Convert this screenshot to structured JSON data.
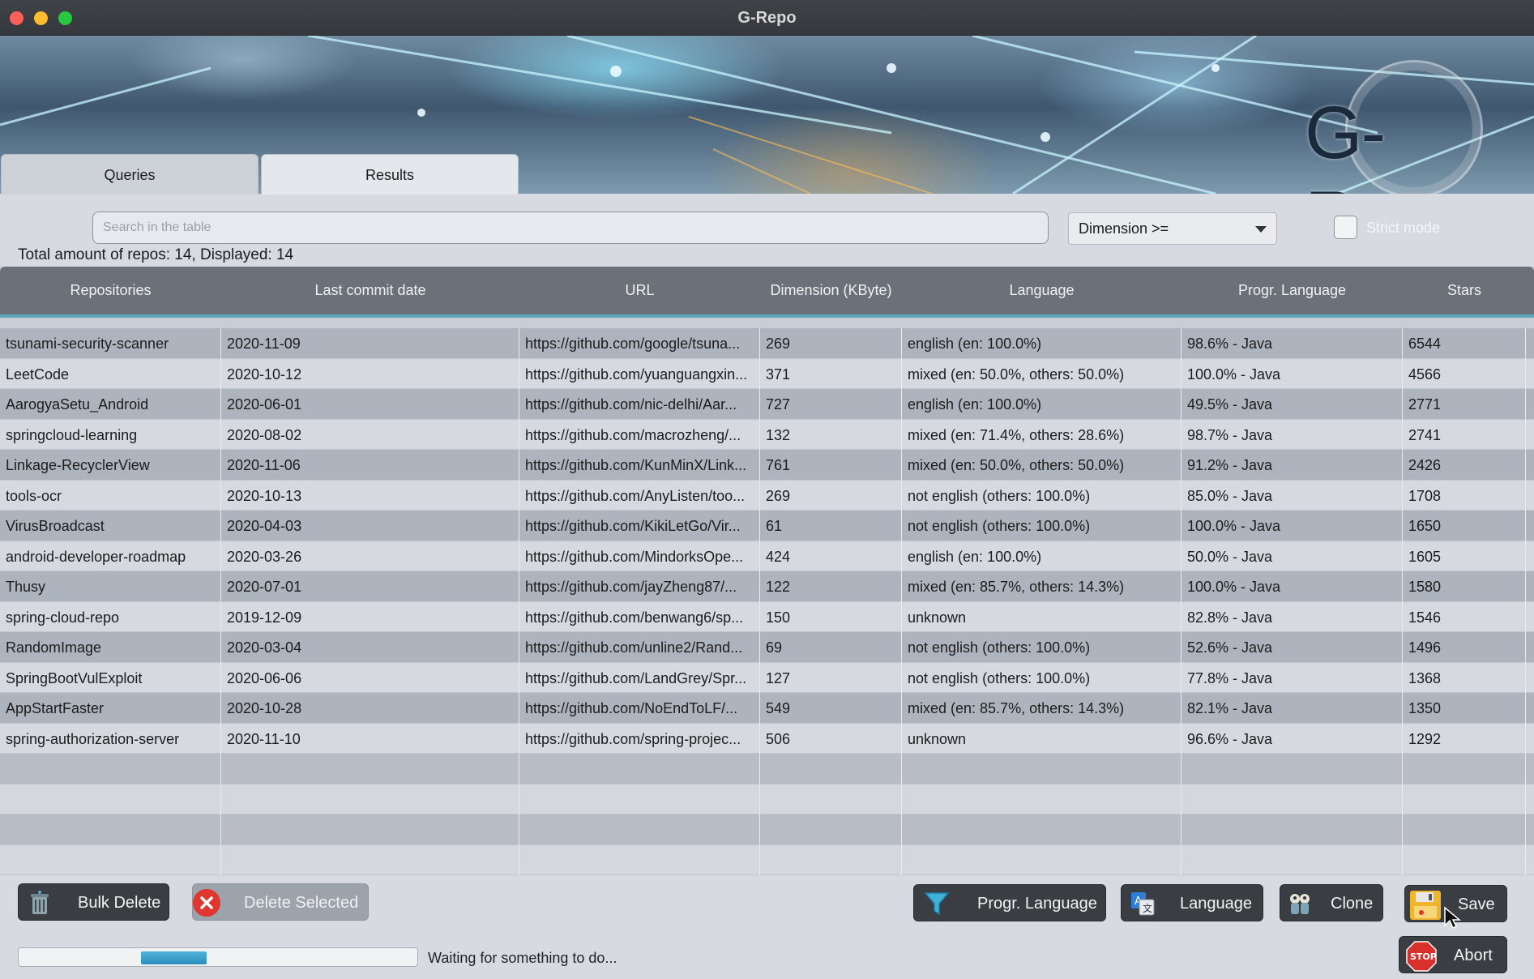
{
  "window": {
    "title": "G-Repo"
  },
  "banner": {
    "logo_text": "G-Repo"
  },
  "tabs": [
    {
      "label": "Queries",
      "active": false
    },
    {
      "label": "Results",
      "active": true
    }
  ],
  "search": {
    "placeholder": "Search in the table",
    "value": ""
  },
  "filter": {
    "selected": "Dimension >="
  },
  "strict_mode": {
    "label": "Strict mode",
    "checked": false
  },
  "summary": {
    "text": "Total amount of repos: 14, Displayed: 14"
  },
  "table": {
    "columns": [
      "Repositories",
      "Last commit date",
      "URL",
      "Dimension (KByte)",
      "Language",
      "Progr. Language",
      "Stars"
    ],
    "rows": [
      [
        "tsunami-security-scanner",
        "2020-11-09",
        "https://github.com/google/tsuna...",
        "269",
        "english (en: 100.0%)",
        "98.6% - Java",
        "6544"
      ],
      [
        "LeetCode",
        "2020-10-12",
        "https://github.com/yuanguangxin...",
        "371",
        "mixed (en: 50.0%, others: 50.0%)",
        "100.0% - Java",
        "4566"
      ],
      [
        "AarogyaSetu_Android",
        "2020-06-01",
        "https://github.com/nic-delhi/Aar...",
        "727",
        "english (en: 100.0%)",
        "49.5% - Java",
        "2771"
      ],
      [
        "springcloud-learning",
        "2020-08-02",
        "https://github.com/macrozheng/...",
        "132",
        "mixed (en: 71.4%, others: 28.6%)",
        "98.7% - Java",
        "2741"
      ],
      [
        "Linkage-RecyclerView",
        "2020-11-06",
        "https://github.com/KunMinX/Link...",
        "761",
        "mixed (en: 50.0%, others: 50.0%)",
        "91.2% - Java",
        "2426"
      ],
      [
        "tools-ocr",
        "2020-10-13",
        "https://github.com/AnyListen/too...",
        "269",
        "not english (others: 100.0%)",
        "85.0% - Java",
        "1708"
      ],
      [
        "VirusBroadcast",
        "2020-04-03",
        "https://github.com/KikiLetGo/Vir...",
        "61",
        "not english (others: 100.0%)",
        "100.0% - Java",
        "1650"
      ],
      [
        "android-developer-roadmap",
        "2020-03-26",
        "https://github.com/MindorksOpe...",
        "424",
        "english (en: 100.0%)",
        "50.0% - Java",
        "1605"
      ],
      [
        "Thusy",
        "2020-07-01",
        "https://github.com/jayZheng87/...",
        "122",
        "mixed (en: 85.7%, others: 14.3%)",
        "100.0% - Java",
        "1580"
      ],
      [
        "spring-cloud-repo",
        "2019-12-09",
        "https://github.com/benwang6/sp...",
        "150",
        "unknown",
        "82.8% - Java",
        "1546"
      ],
      [
        "RandomImage",
        "2020-03-04",
        "https://github.com/unline2/Rand...",
        "69",
        "not english (others: 100.0%)",
        "52.6% - Java",
        "1496"
      ],
      [
        "SpringBootVulExploit",
        "2020-06-06",
        "https://github.com/LandGrey/Spr...",
        "127",
        "not english (others: 100.0%)",
        "77.8% - Java",
        "1368"
      ],
      [
        "AppStartFaster",
        "2020-10-28",
        "https://github.com/NoEndToLF/...",
        "549",
        "mixed (en: 85.7%, others: 14.3%)",
        "82.1% - Java",
        "1350"
      ],
      [
        "spring-authorization-server",
        "2020-11-10",
        "https://github.com/spring-projec...",
        "506",
        "unknown",
        "96.6% - Java",
        "1292"
      ]
    ]
  },
  "buttons": {
    "bulk_delete": {
      "label": "Bulk Delete",
      "icon": "trash-bin-icon"
    },
    "delete_selected": {
      "label": "Delete Selected",
      "icon": "red-x-circle-icon"
    },
    "progr_language": {
      "label": "Progr. Language",
      "icon": "funnel-filter-icon"
    },
    "language": {
      "label": "Language",
      "icon": "translate-icon"
    },
    "clone": {
      "label": "Clone",
      "icon": "sheep-clone-icon"
    },
    "save": {
      "label": "Save",
      "icon": "floppy-disk-icon"
    },
    "abort": {
      "label": "Abort",
      "icon": "stop-sign-icon"
    }
  },
  "status": {
    "progress": 0.16,
    "text": "Waiting for something to do..."
  },
  "colors": {
    "header_bg": "#6b7178",
    "header_accent": "#5ea7b8",
    "progress_fill": "#2a8fbe",
    "delete_red": "#e0362e"
  }
}
